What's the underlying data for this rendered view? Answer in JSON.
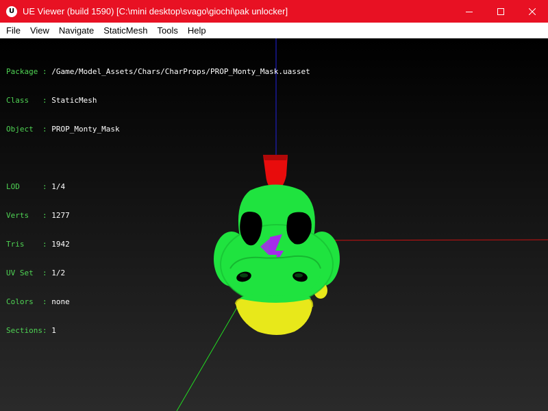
{
  "window": {
    "title": "UE Viewer (build 1590) [C:\\mini desktop\\svago\\giochi\\pak unlocker]",
    "icon": "unreal-engine-logo"
  },
  "menu": [
    "File",
    "View",
    "Navigate",
    "StaticMesh",
    "Tools",
    "Help"
  ],
  "info": {
    "rows": [
      {
        "label": "Package : ",
        "value": "/Game/Model_Assets/Chars/CharProps/PROP_Monty_Mask.uasset"
      },
      {
        "label": "Class   : ",
        "value": "StaticMesh"
      },
      {
        "label": "Object  : ",
        "value": "PROP_Monty_Mask"
      }
    ],
    "stats": [
      {
        "label": "LOD     : ",
        "value": "1/4"
      },
      {
        "label": "Verts   : ",
        "value": "1277"
      },
      {
        "label": "Tris    : ",
        "value": "1942"
      },
      {
        "label": "UV Set  : ",
        "value": "1/2"
      },
      {
        "label": "Colors  : ",
        "value": "none"
      },
      {
        "label": "Sections: ",
        "value": "1"
      }
    ]
  },
  "colors": {
    "titlebar": "#e81123",
    "label_green": "#4fd454",
    "mask_green": "#1fe33f",
    "mask_yellow": "#e8e81a",
    "bolt_purple": "#a52bea",
    "crest_red": "#e80c0c",
    "axis_x": "#cc1111",
    "axis_y": "#22dd22",
    "axis_z": "#2222dd"
  }
}
